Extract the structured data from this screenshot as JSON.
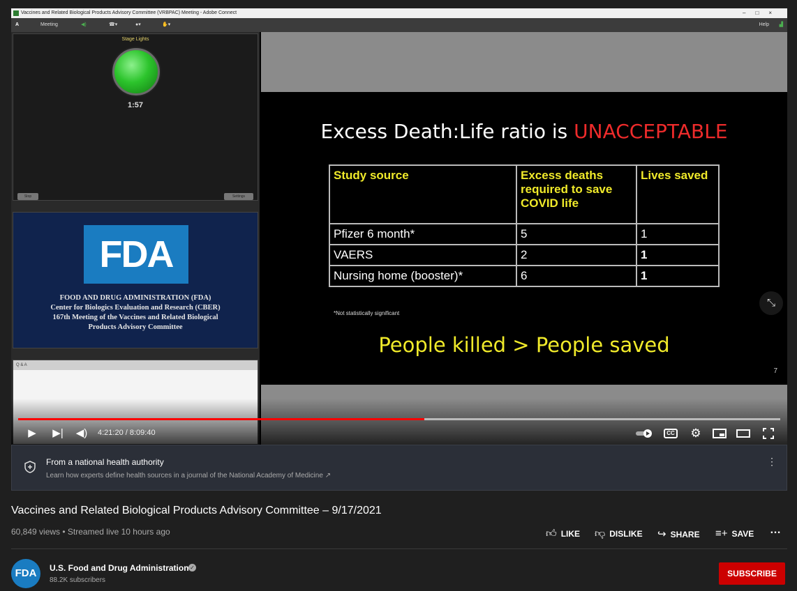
{
  "player": {
    "window_title": "Vaccines and Related Biological Products Advisory Committee (VRBPAC) Meeting - Adobe Connect",
    "menu": {
      "meeting": "Meeting",
      "help": "Help"
    },
    "stage": {
      "title": "Stage Lights",
      "timer": "1:57",
      "stop_label": "Stop",
      "settings_label": "Settings"
    },
    "fda_pod": {
      "logo": "FDA",
      "line1": "FOOD AND DRUG ADMINISTRATION (FDA)",
      "line2": "Center for Biologics Evaluation and Research (CBER)",
      "line3": "167th  Meeting of the Vaccines and Related Biological",
      "line4": "Products Advisory Committee"
    },
    "qa_title": "Q & A",
    "slide": {
      "title_prefix": "Excess Death:Life ratio is ",
      "title_highlight": "UNACCEPTABLE",
      "table_headers": [
        "Study source",
        "Excess deaths required to save COVID life",
        "Lives saved"
      ],
      "table_rows": [
        [
          "Pfizer 6 month*",
          "5",
          "1"
        ],
        [
          "VAERS",
          "2",
          "1"
        ],
        [
          "Nursing home (booster)*",
          "6",
          "1"
        ]
      ],
      "note": "*Not statistically significant",
      "footer": "People killed > People saved",
      "page_number": "7"
    },
    "time_display": "4:21:20 / 8:09:40",
    "progress_fraction": 0.533,
    "buffer_fraction": 1.0,
    "icons": {
      "play": "play-icon",
      "next": "next-icon",
      "volume": "volume-icon",
      "autoplay": "autoplay-toggle-icon",
      "captions": "captions-icon",
      "settings": "gear-icon",
      "miniplayer": "miniplayer-icon",
      "theater": "theater-icon",
      "fullscreen": "fullscreen-icon"
    },
    "captions_label": "CC"
  },
  "info_panel": {
    "title": "From a national health authority",
    "subtitle": "Learn how experts define health sources in a journal of the National Academy of Medicine"
  },
  "video": {
    "title": "Vaccines and Related Biological Products Advisory Committee – 9/17/2021",
    "stats": "60,849 views • Streamed live 10 hours ago"
  },
  "actions": {
    "like": "LIKE",
    "dislike": "DISLIKE",
    "share": "SHARE",
    "save": "SAVE"
  },
  "channel": {
    "avatar_text": "FDA",
    "name": "U.S. Food and Drug Administration",
    "subscribers": "88.2K subscribers",
    "subscribe_label": "SUBSCRIBE"
  },
  "colors": {
    "progress": "#ff0000",
    "subscribe": "#cc0000",
    "fda_blue": "#1a7cc1",
    "slide_yellow": "#f0ea2a",
    "slide_red": "#ee2b2b"
  }
}
